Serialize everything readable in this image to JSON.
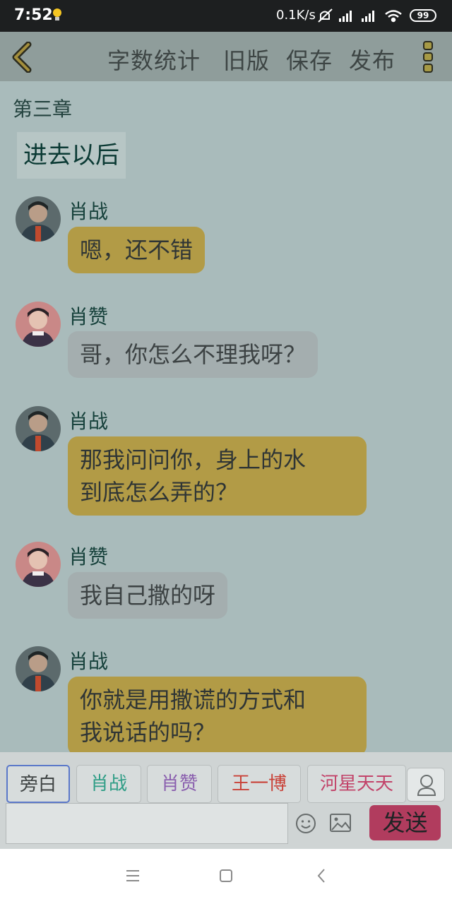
{
  "status": {
    "time": "7:52",
    "speed": "0.1K/s",
    "battery": "99"
  },
  "toolbar": {
    "back_icon": "chevron-left-icon",
    "actions": [
      "字数统计",
      "旧版",
      "保存",
      "发布"
    ],
    "more_icon": "more-vertical-icon"
  },
  "chapter": "第三章",
  "section_title": "进去以后",
  "messages": [
    {
      "speaker": "肖战",
      "lines": [
        "嗯，还不错"
      ],
      "style": "gold"
    },
    {
      "speaker": "肖赞",
      "lines": [
        "哥，你怎么不理我呀？"
      ],
      "style": "grey"
    },
    {
      "speaker": "肖战",
      "lines": [
        "那我问问你，身上的水",
        "到底怎么弄的？"
      ],
      "style": "gold"
    },
    {
      "speaker": "肖赞",
      "lines": [
        "我自己撒的呀"
      ],
      "style": "grey"
    },
    {
      "speaker": "肖战",
      "lines": [
        "你就是用撒谎的方式和",
        "我说话的吗？"
      ],
      "style": "gold"
    }
  ],
  "roles": [
    {
      "label": "旁白",
      "color": "#3f4444"
    },
    {
      "label": "肖战",
      "color": "#2f9d86"
    },
    {
      "label": "肖赞",
      "color": "#8a5fae"
    },
    {
      "label": "王一博",
      "color": "#c94238"
    },
    {
      "label": "河星天天",
      "color": "#c2446a"
    }
  ],
  "input": {
    "placeholder": ""
  },
  "send_label": "发送",
  "colors": {
    "gold_bubble": "#b29b46",
    "grey_bubble": "#a4aeaf",
    "send": "#b13c5e"
  }
}
